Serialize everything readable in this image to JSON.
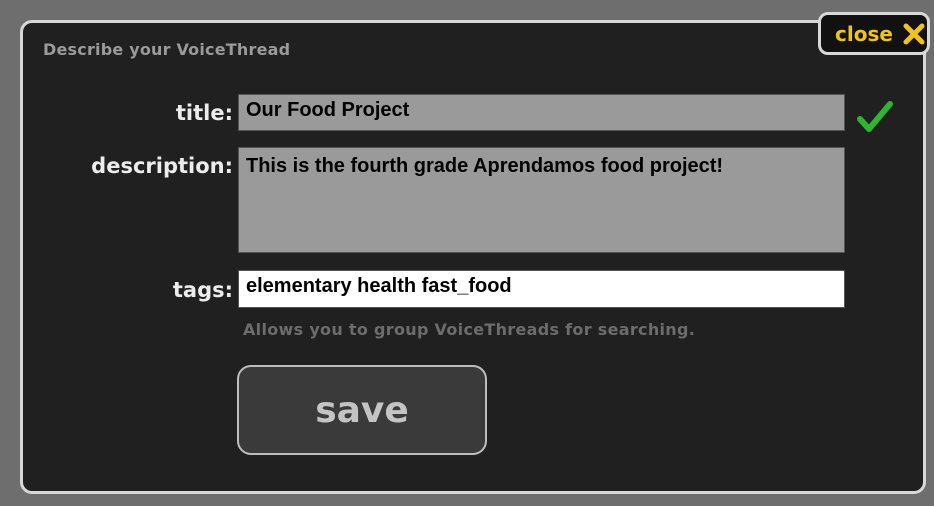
{
  "dialog": {
    "title": "Describe your VoiceThread",
    "close_label": "close"
  },
  "form": {
    "title_label": "title:",
    "title_value": "Our Food Project",
    "description_label": "description:",
    "description_value": "This is the fourth grade Aprendamos food project!",
    "tags_label": "tags:",
    "tags_value": "elementary health fast_food",
    "tags_hint": "Allows you to group VoiceThreads for searching.",
    "save_label": "save"
  },
  "icons": {
    "close": "close-x-icon",
    "valid": "checkmark-icon"
  },
  "colors": {
    "accent": "#f0c21c",
    "check": "#2fb52f",
    "panel": "#202020"
  }
}
